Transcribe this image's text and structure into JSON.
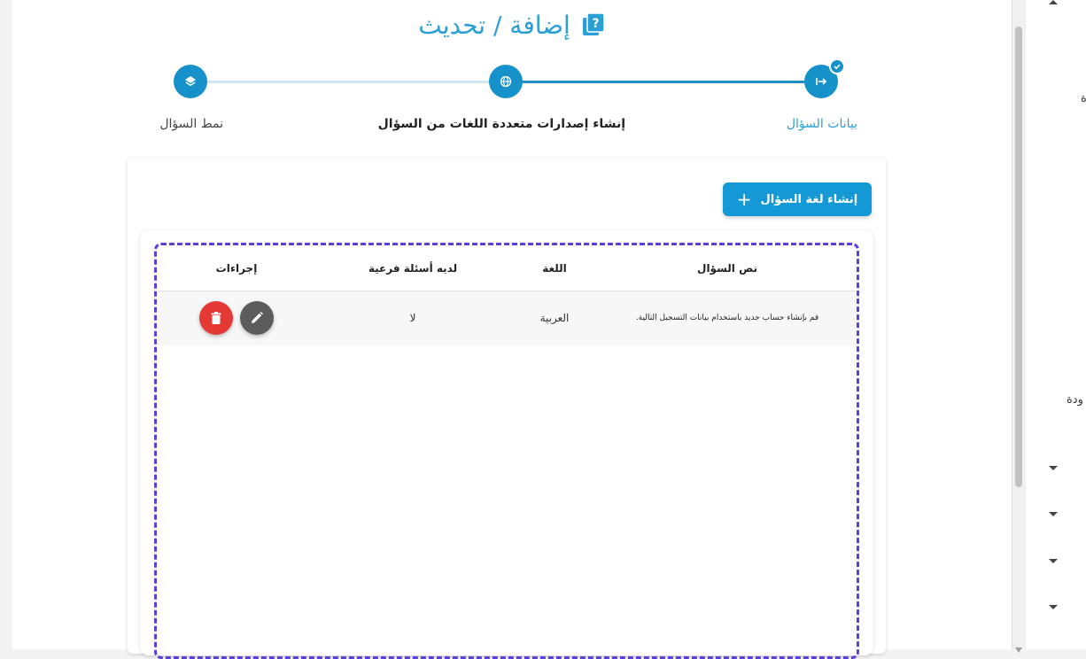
{
  "page": {
    "title": "إضافة / تحديث"
  },
  "stepper": {
    "steps": [
      {
        "label": "بيانات السؤال",
        "icon": "arrow-into-box-icon",
        "state": "completed"
      },
      {
        "label": "إنشاء إصدارات متعددة اللغات من السؤال",
        "icon": "globe-icon",
        "state": "active"
      },
      {
        "label": "نمط السؤال",
        "icon": "layers-icon",
        "state": "upcoming"
      }
    ]
  },
  "toolbar": {
    "add_language_label": "إنشاء لغة السؤال",
    "add_icon": "+"
  },
  "table": {
    "columns": [
      "نص السؤال",
      "اللغة",
      "لديه أسئلة فرعية",
      "إجراءات"
    ],
    "rows": [
      {
        "question_text": "قم بإنشاء حساب جديد باستخدام بيانات التسجيل التالية.",
        "language": "العربية",
        "has_sub_questions": "لا"
      }
    ]
  },
  "side_panel": {
    "partial_text_1": "ة",
    "partial_text_2": "ودة"
  },
  "colors": {
    "primary": "#1599d6",
    "title": "#2a9fd6",
    "delete": "#e53935",
    "edit": "#5c5c5c",
    "dashed_outline": "#5b3fd9"
  }
}
